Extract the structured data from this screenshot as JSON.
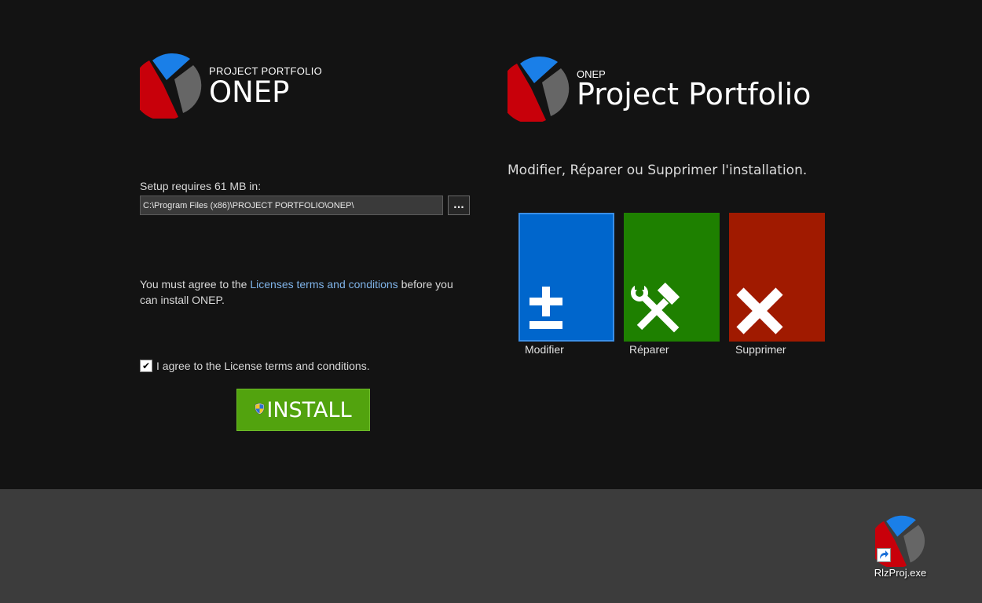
{
  "left_panel": {
    "brand_small": "PROJECT PORTFOLIO",
    "brand_big": "ONEP",
    "setup_label": "Setup requires 61 MB in:",
    "install_path": "C:\\Program Files (x86)\\PROJECT PORTFOLIO\\ONEP\\",
    "browse_label": "...",
    "license_prefix": "You must agree to the ",
    "license_link": "Licenses terms and conditions",
    "license_suffix": " before you can install ONEP.",
    "agree_label": "I agree to the License terms and conditions.",
    "agree_checked": true,
    "install_label": "INSTALL"
  },
  "right_panel": {
    "brand_small": "ONEP",
    "brand_big": "Project Portfolio",
    "subtitle": "Modifier, Réparer ou Supprimer l'installation.",
    "tiles": [
      {
        "label": "Modifier",
        "icon": "plus-minus-icon",
        "color": "#0066cc"
      },
      {
        "label": "Réparer",
        "icon": "tools-icon",
        "color": "#1e8000"
      },
      {
        "label": "Supprimer",
        "icon": "x-icon",
        "color": "#a01a00"
      }
    ]
  },
  "desktop": {
    "shortcut_label": "RlzProj.exe"
  },
  "colors": {
    "logo_blue": "#1a7fe8",
    "logo_red": "#c8000a",
    "logo_gray": "#666666",
    "install_green": "#52a30e"
  }
}
